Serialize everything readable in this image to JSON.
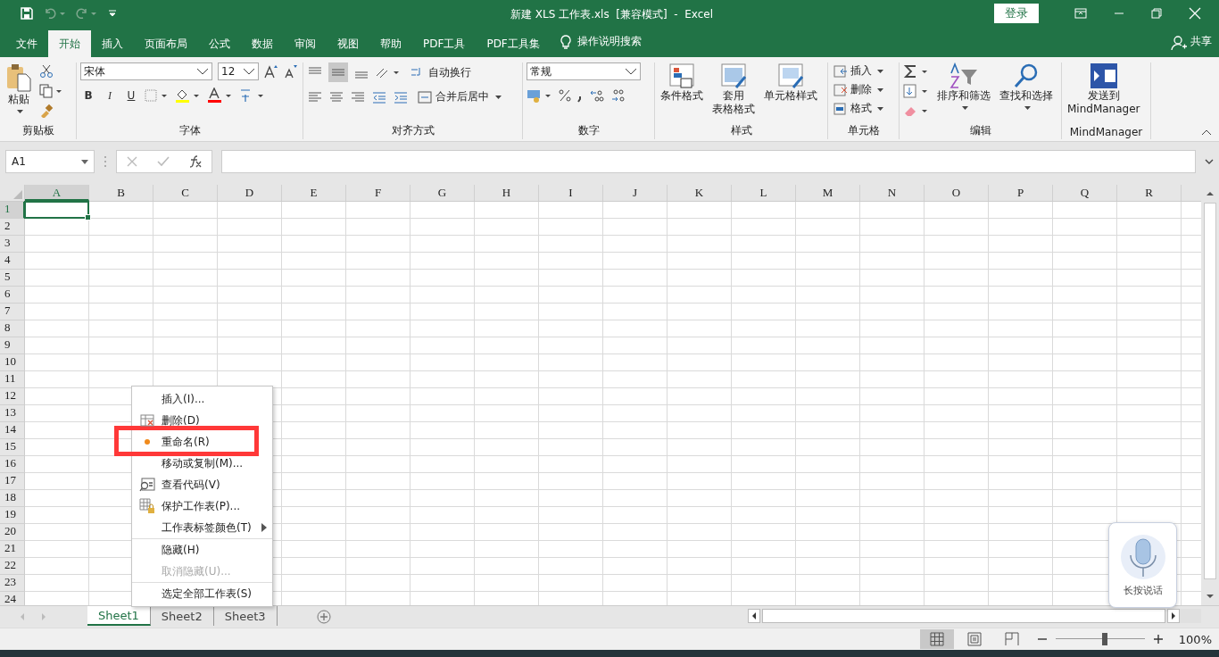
{
  "title_bar": {
    "title": "新建 XLS 工作表.xls  [兼容模式]  -  Excel",
    "login_button": "登录"
  },
  "menu_tabs": [
    {
      "label": "文件",
      "selected": false
    },
    {
      "label": "开始",
      "selected": true
    },
    {
      "label": "插入",
      "selected": false
    },
    {
      "label": "页面布局",
      "selected": false
    },
    {
      "label": "公式",
      "selected": false
    },
    {
      "label": "数据",
      "selected": false
    },
    {
      "label": "审阅",
      "selected": false
    },
    {
      "label": "视图",
      "selected": false
    },
    {
      "label": "帮助",
      "selected": false
    },
    {
      "label": "PDF工具",
      "selected": false
    },
    {
      "label": "PDF工具集",
      "selected": false
    }
  ],
  "tell_me": "操作说明搜索",
  "share": "共享",
  "ribbon": {
    "clipboard": {
      "paste": "粘贴",
      "label": "剪贴板"
    },
    "font": {
      "font_name": "宋体",
      "font_size": "12",
      "format_buttons": [
        "B",
        "I",
        "U"
      ],
      "label": "字体"
    },
    "alignment": {
      "wrap_text": "自动换行",
      "merge": "合并后居中",
      "label": "对齐方式"
    },
    "number": {
      "format": "常规",
      "label": "数字"
    },
    "styles": {
      "buttons": [
        [
          "条件格式"
        ],
        [
          "套用",
          "表格格式"
        ],
        [
          "单元格样式"
        ]
      ],
      "label": "样式"
    },
    "cells": {
      "items": [
        "插入",
        "删除",
        "格式"
      ],
      "label": "单元格"
    },
    "editing": {
      "buttons": [
        "排序和筛选",
        "查找和选择"
      ],
      "label": "编辑"
    },
    "mindmanager": {
      "button": [
        "发送到",
        "MindManager"
      ],
      "label": "MindManager"
    }
  },
  "formula_bar": {
    "name_box": "A1"
  },
  "columns": [
    {
      "label": "A",
      "selected": true
    },
    {
      "label": "B",
      "selected": false
    },
    {
      "label": "C",
      "selected": false
    },
    {
      "label": "D",
      "selected": false
    },
    {
      "label": "E",
      "selected": false
    },
    {
      "label": "F",
      "selected": false
    },
    {
      "label": "G",
      "selected": false
    },
    {
      "label": "H",
      "selected": false
    },
    {
      "label": "I",
      "selected": false
    },
    {
      "label": "J",
      "selected": false
    },
    {
      "label": "K",
      "selected": false
    },
    {
      "label": "L",
      "selected": false
    },
    {
      "label": "M",
      "selected": false
    },
    {
      "label": "N",
      "selected": false
    },
    {
      "label": "O",
      "selected": false
    },
    {
      "label": "P",
      "selected": false
    },
    {
      "label": "Q",
      "selected": false
    },
    {
      "label": "R",
      "selected": false
    }
  ],
  "rows": [
    {
      "label": "1",
      "selected": true
    },
    {
      "label": "2",
      "selected": false
    },
    {
      "label": "3",
      "selected": false
    },
    {
      "label": "4",
      "selected": false
    },
    {
      "label": "5",
      "selected": false
    },
    {
      "label": "6",
      "selected": false
    },
    {
      "label": "7",
      "selected": false
    },
    {
      "label": "8",
      "selected": false
    },
    {
      "label": "9",
      "selected": false
    },
    {
      "label": "10",
      "selected": false
    },
    {
      "label": "11",
      "selected": false
    },
    {
      "label": "12",
      "selected": false
    },
    {
      "label": "13",
      "selected": false
    },
    {
      "label": "14",
      "selected": false
    },
    {
      "label": "15",
      "selected": false
    },
    {
      "label": "16",
      "selected": false
    },
    {
      "label": "17",
      "selected": false
    },
    {
      "label": "18",
      "selected": false
    },
    {
      "label": "19",
      "selected": false
    },
    {
      "label": "20",
      "selected": false
    },
    {
      "label": "21",
      "selected": false
    },
    {
      "label": "22",
      "selected": false
    },
    {
      "label": "23",
      "selected": false
    },
    {
      "label": "24",
      "selected": false
    }
  ],
  "context_menu": [
    {
      "label": "插入(I)...",
      "kind": "plain",
      "disabled": false,
      "separator_before": false
    },
    {
      "label": "删除(D)",
      "kind": "delete",
      "disabled": false,
      "separator_before": false
    },
    {
      "label": "重命名(R)",
      "kind": "rename",
      "disabled": false,
      "separator_before": false
    },
    {
      "label": "移动或复制(M)...",
      "kind": "plain",
      "disabled": false,
      "separator_before": false
    },
    {
      "label": "查看代码(V)",
      "kind": "code",
      "disabled": false,
      "separator_before": false
    },
    {
      "label": "保护工作表(P)...",
      "kind": "protect",
      "disabled": false,
      "separator_before": false
    },
    {
      "label": "工作表标签颜色(T)",
      "kind": "submenu",
      "disabled": false,
      "separator_before": false
    },
    {
      "label": "隐藏(H)",
      "kind": "plain",
      "disabled": false,
      "separator_before": true
    },
    {
      "label": "取消隐藏(U)...",
      "kind": "plain",
      "disabled": true,
      "separator_before": false
    },
    {
      "label": "选定全部工作表(S)",
      "kind": "plain",
      "disabled": false,
      "separator_before": true
    }
  ],
  "sheet_tabs": [
    {
      "label": "Sheet1",
      "selected": true
    },
    {
      "label": "Sheet2",
      "selected": false
    },
    {
      "label": "Sheet3",
      "selected": false
    }
  ],
  "view_buttons": [
    {
      "kind": "normal",
      "selected": true
    },
    {
      "kind": "page_layout",
      "selected": false
    },
    {
      "kind": "page_break",
      "selected": false
    }
  ],
  "zoom": {
    "level": 0.55,
    "reading": "100%"
  },
  "voice_widget": {
    "label": "长按说话"
  }
}
